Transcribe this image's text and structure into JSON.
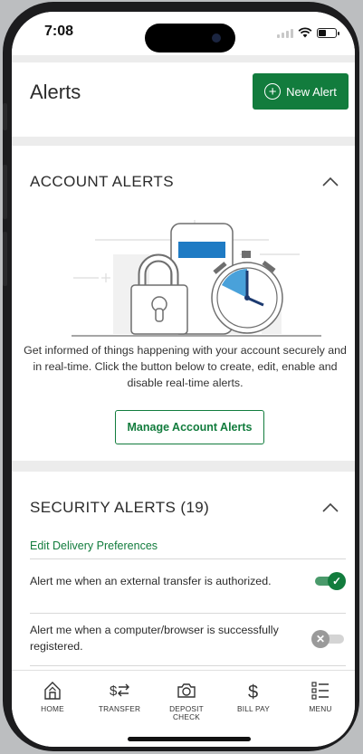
{
  "status_bar": {
    "time": "7:08"
  },
  "header": {
    "title": "Alerts",
    "new_alert_label": "New Alert"
  },
  "account_alerts": {
    "title": "ACCOUNT ALERTS",
    "description": "Get informed of things happening with your account securely and in real-time. Click the button below to create, edit, enable and disable real-time alerts.",
    "manage_label": "Manage Account Alerts"
  },
  "security_alerts": {
    "title": "SECURITY ALERTS (19)",
    "edit_link": "Edit Delivery Preferences",
    "items": [
      {
        "text": "Alert me when an external transfer is authorized.",
        "enabled": true
      },
      {
        "text": "Alert me when a computer/browser is successfully registered.",
        "enabled": false
      }
    ]
  },
  "bottom_nav": [
    {
      "label": "HOME",
      "icon": "home-icon"
    },
    {
      "label": "TRANSFER",
      "icon": "transfer-icon"
    },
    {
      "label": "DEPOSIT CHECK",
      "icon": "camera-icon"
    },
    {
      "label": "BILL PAY",
      "icon": "dollar-icon"
    },
    {
      "label": "MENU",
      "icon": "menu-icon"
    }
  ],
  "colors": {
    "brand_green": "#127c3d",
    "toggle_on": "#127c3d",
    "toggle_off": "#cfcfcf",
    "illustration_blue": "#1f7bc4"
  }
}
